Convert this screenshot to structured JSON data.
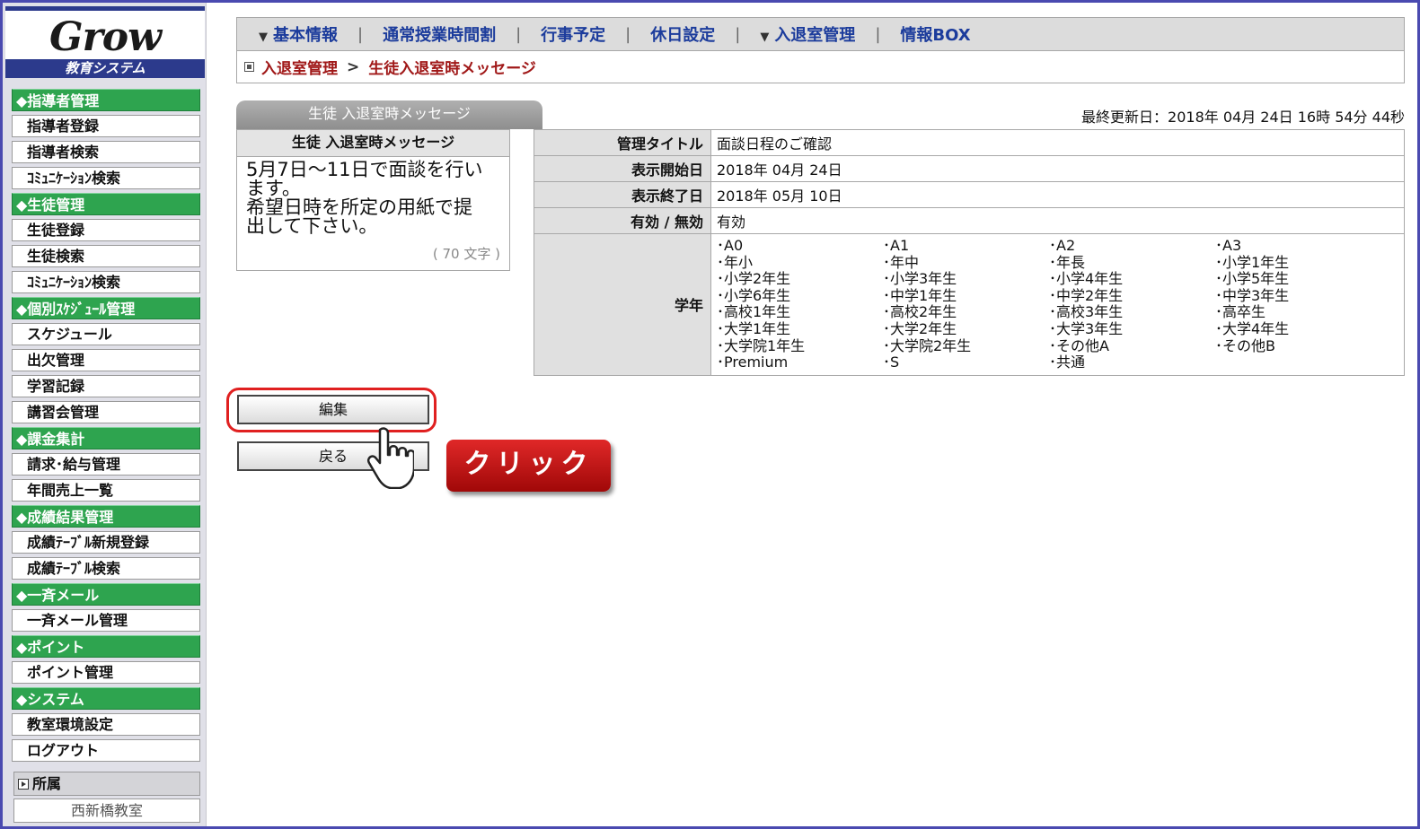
{
  "logo": {
    "word": "Grow",
    "subtitle": "教育システム"
  },
  "sidebar": {
    "sections": [
      {
        "title": "◆指導者管理",
        "items": [
          "指導者登録",
          "指導者検索",
          "ｺﾐｭﾆｹｰｼｮﾝ検索"
        ]
      },
      {
        "title": "◆生徒管理",
        "items": [
          "生徒登録",
          "生徒検索",
          "ｺﾐｭﾆｹｰｼｮﾝ検索"
        ]
      },
      {
        "title": "◆個別ｽｹｼﾞｭｰﾙ管理",
        "items": [
          "スケジュール",
          "出欠管理",
          "学習記録",
          "講習会管理"
        ]
      },
      {
        "title": "◆課金集計",
        "items": [
          "請求･給与管理",
          "年間売上一覧"
        ]
      },
      {
        "title": "◆成績結果管理",
        "items": [
          "成績ﾃｰﾌﾞﾙ新規登録",
          "成績ﾃｰﾌﾞﾙ検索"
        ]
      },
      {
        "title": "◆一斉メール",
        "items": [
          "一斉メール管理"
        ]
      },
      {
        "title": "◆ポイント",
        "items": [
          "ポイント管理"
        ]
      },
      {
        "title": "◆システム",
        "items": [
          "教室環境設定",
          "ログアウト"
        ]
      }
    ],
    "affiliation_label": "所属",
    "affiliation_value": "西新橋教室"
  },
  "topnav": {
    "links": [
      "基本情報",
      "通常授業時間割",
      "行事予定",
      "休日設定",
      "入退室管理",
      "情報BOX"
    ],
    "separator": "|"
  },
  "breadcrumb": {
    "parent": "入退室管理",
    "separator": ">",
    "current": "生徒入退室時メッセージ"
  },
  "panel": {
    "tab_title": "生徒 入退室時メッセージ",
    "last_updated": "最終更新日：2018年 04月 24日 16時 54分 44秒",
    "message_header": "生徒 入退室時メッセージ",
    "message_lines": [
      "5月7日～11日で面談を行い",
      "ます。",
      "希望日時を所定の用紙で提",
      "出して下さい。"
    ],
    "char_count": "( 70 文字 )"
  },
  "detail": {
    "title_label": "管理タイトル",
    "title_value": "面談日程のご確認",
    "start_label": "表示開始日",
    "start_value": "2018年 04月 24日",
    "end_label": "表示終了日",
    "end_value": "2018年 05月 10日",
    "valid_label": "有効 / 無効",
    "valid_value": "有効",
    "grade_label": "学年",
    "grades": [
      "･A0",
      "･A1",
      "･A2",
      "･A3",
      "･年小",
      "･年中",
      "･年長",
      "･小学1年生",
      "･小学2年生",
      "･小学3年生",
      "･小学4年生",
      "･小学5年生",
      "･小学6年生",
      "･中学1年生",
      "･中学2年生",
      "･中学3年生",
      "･高校1年生",
      "･高校2年生",
      "･高校3年生",
      "･高卒生",
      "･大学1年生",
      "･大学2年生",
      "･大学3年生",
      "･大学4年生",
      "･大学院1年生",
      "･大学院2年生",
      "･その他A",
      "･その他B",
      "･Premium",
      "･S",
      "･共通",
      ""
    ]
  },
  "buttons": {
    "edit": "編集",
    "back": "戻る"
  },
  "callout": {
    "label": "クリック"
  }
}
